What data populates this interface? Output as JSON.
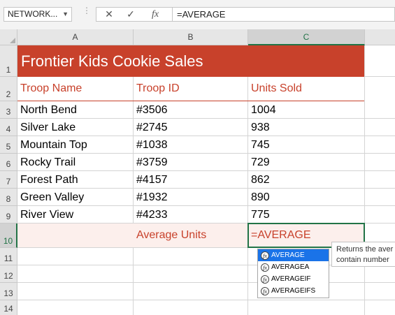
{
  "formula_bar": {
    "name_box": "NETWORK...",
    "separator": "⋮",
    "cancel_symbol": "✕",
    "enter_symbol": "✓",
    "fx_symbol": "fx",
    "formula": "=AVERAGE"
  },
  "columns": [
    {
      "label": "A"
    },
    {
      "label": "B"
    },
    {
      "label": "C"
    }
  ],
  "rows": [
    "1",
    "2",
    "3",
    "4",
    "5",
    "6",
    "7",
    "8",
    "9",
    "10",
    "11",
    "12",
    "13",
    "14"
  ],
  "sheet": {
    "title": "Frontier Kids Cookie Sales",
    "headers": [
      "Troop Name",
      "Troop ID",
      "Units Sold"
    ],
    "data": [
      {
        "name": "North Bend",
        "id": "#3506",
        "units": "1004"
      },
      {
        "name": "Silver Lake",
        "id": "#2745",
        "units": "938"
      },
      {
        "name": "Mountain Top",
        "id": "#1038",
        "units": "745"
      },
      {
        "name": "Rocky Trail",
        "id": "#3759",
        "units": "729"
      },
      {
        "name": "Forest Path",
        "id": "#4157",
        "units": "862"
      },
      {
        "name": "Green Valley",
        "id": "#1932",
        "units": "890"
      },
      {
        "name": "River View",
        "id": "#4233",
        "units": "775"
      }
    ],
    "average_label": "Average Units",
    "active_cell_value": "=AVERAGE"
  },
  "autocomplete": {
    "icon_label": "fx",
    "items": [
      "AVERAGE",
      "AVERAGEA",
      "AVERAGEIF",
      "AVERAGEIFS"
    ],
    "selected_index": 0,
    "tooltip_lines": [
      "Returns the aver",
      "contain number"
    ]
  },
  "colors": {
    "accent": "#c8412b",
    "selection": "#217346",
    "average_fill": "#fcefec"
  }
}
